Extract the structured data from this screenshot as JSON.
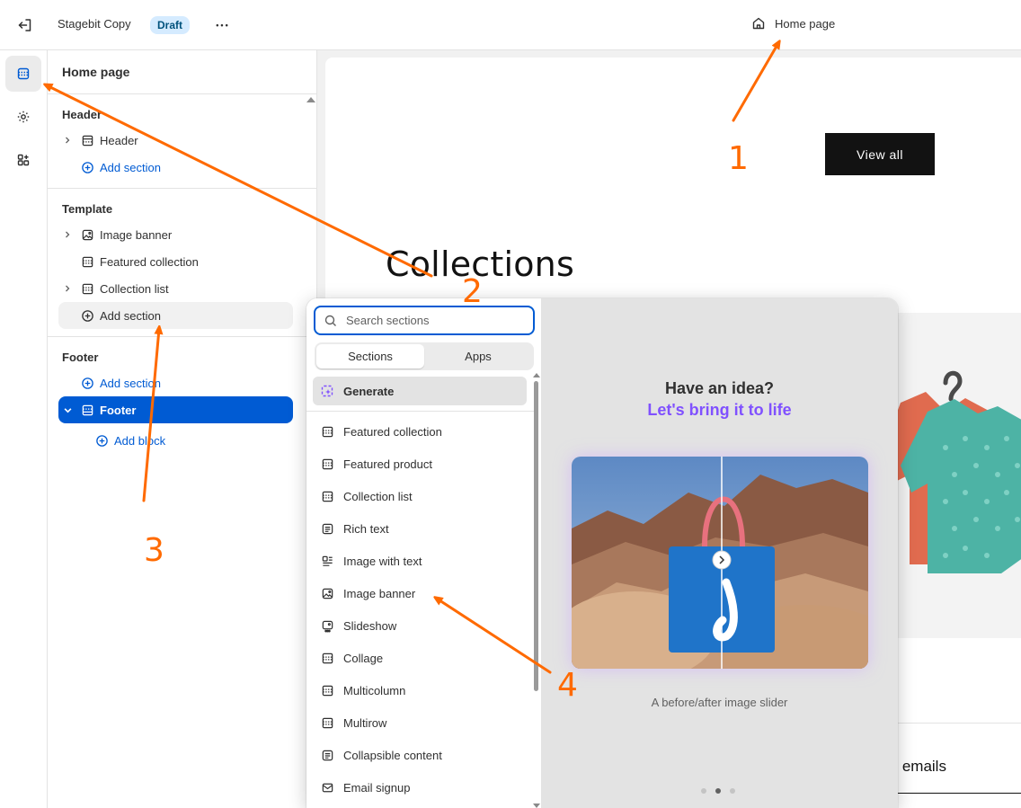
{
  "topbar": {
    "store_name": "Stagebit Copy",
    "status_badge": "Draft",
    "more_label": "•••",
    "page_selector": "Home page"
  },
  "sidebar": {
    "title": "Home page",
    "groups": [
      {
        "title": "Header",
        "items": [
          {
            "label": "Header",
            "icon": "header-section-icon",
            "expandable": true
          },
          {
            "label": "Add section",
            "type": "add"
          }
        ]
      },
      {
        "title": "Template",
        "items": [
          {
            "label": "Image banner",
            "icon": "image-icon",
            "expandable": true
          },
          {
            "label": "Featured collection",
            "icon": "section-icon"
          },
          {
            "label": "Collection list",
            "icon": "section-icon",
            "expandable": true
          },
          {
            "label": "Add section",
            "type": "add"
          }
        ]
      },
      {
        "title": "Footer",
        "items": [
          {
            "label": "Add section",
            "type": "add"
          },
          {
            "label": "Footer",
            "icon": "footer-section-icon",
            "selected": true
          },
          {
            "label": "Add block",
            "type": "add"
          }
        ]
      }
    ]
  },
  "preview": {
    "view_all_label": "View all",
    "collections_title": "Collections",
    "emails_text": "ur emails",
    "arrow_glyph": "›"
  },
  "picker": {
    "search_placeholder": "Search sections",
    "tabs": [
      "Sections",
      "Apps"
    ],
    "active_tab": "Sections",
    "generate_label": "Generate",
    "sections": [
      {
        "label": "Featured collection",
        "icon": "section-icon"
      },
      {
        "label": "Featured product",
        "icon": "section-icon"
      },
      {
        "label": "Collection list",
        "icon": "section-icon"
      },
      {
        "label": "Rich text",
        "icon": "text-icon"
      },
      {
        "label": "Image with text",
        "icon": "image-text-icon"
      },
      {
        "label": "Image banner",
        "icon": "image-icon"
      },
      {
        "label": "Slideshow",
        "icon": "slideshow-icon"
      },
      {
        "label": "Collage",
        "icon": "section-icon"
      },
      {
        "label": "Multicolumn",
        "icon": "section-icon"
      },
      {
        "label": "Multirow",
        "icon": "section-icon"
      },
      {
        "label": "Collapsible content",
        "icon": "text-icon"
      },
      {
        "label": "Email signup",
        "icon": "email-icon"
      }
    ],
    "promo": {
      "title": "Have an idea?",
      "subtitle": "Let's bring it to life",
      "caption": "A before/after image slider"
    }
  },
  "annotations": [
    "1",
    "2",
    "3",
    "4"
  ],
  "colors": {
    "accent": "#005bd3",
    "annotation": "#ff6a00",
    "promo_purple": "#8051ff",
    "draft_badge_bg": "#d5ebff"
  }
}
